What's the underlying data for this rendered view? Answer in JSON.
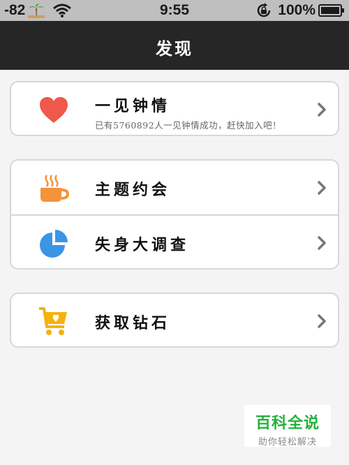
{
  "status_bar": {
    "signal": "-82",
    "time": "9:55",
    "battery_percent": "100%",
    "icons": [
      "palm-tree-icon",
      "wifi-icon",
      "rotation-lock-icon",
      "battery-icon"
    ]
  },
  "nav": {
    "title": "发现"
  },
  "groups": [
    {
      "rows": [
        {
          "title": "一见钟情",
          "subtitle": "已有5760892人一见钟情成功，赶快加入吧！",
          "icon": "heart-icon",
          "icon_color": "#f0584b"
        }
      ]
    },
    {
      "rows": [
        {
          "title": "主题约会",
          "icon": "coffee-cup-icon",
          "icon_color": "#f5923c"
        },
        {
          "title": "失身大调查",
          "icon": "pie-chart-icon",
          "icon_color": "#3a95e6"
        }
      ]
    },
    {
      "rows": [
        {
          "title": "获取钻石",
          "icon": "shopping-cart-icon",
          "icon_color": "#f5b20f"
        }
      ]
    }
  ],
  "watermark": {
    "main": "百科全说",
    "sub": "助你轻松解决"
  },
  "colors": {
    "nav_background": "#262626",
    "chevron": "#777777",
    "watermark_green": "#24b13a"
  }
}
